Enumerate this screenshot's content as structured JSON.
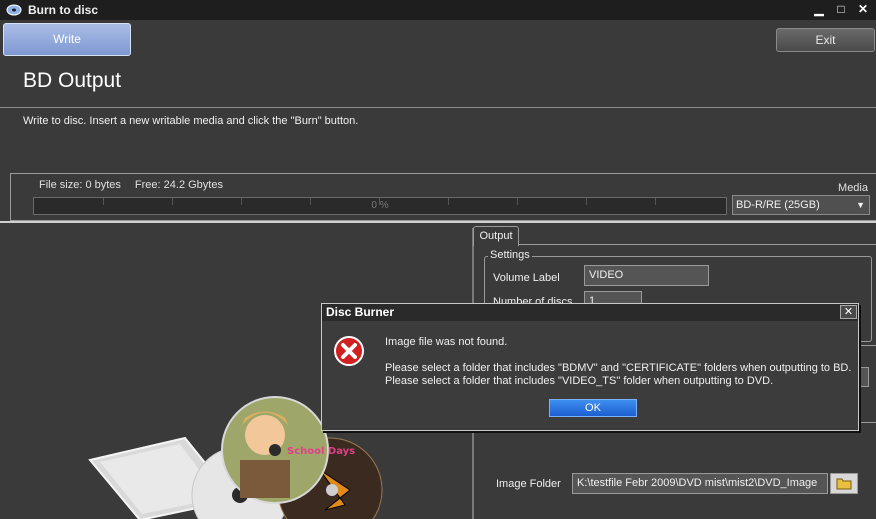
{
  "window": {
    "title": "Burn to disc",
    "minimize": "▁",
    "maximize": "□",
    "close": "✕"
  },
  "toolbar": {
    "write_label": "Write",
    "exit_label": "Exit"
  },
  "page": {
    "title": "BD Output",
    "instructions": "Write to disc. Insert a new writable media and click the \"Burn\" button."
  },
  "progress": {
    "file_size": "File size: 0 bytes",
    "free": "Free: 24.2 Gbytes",
    "percent_text": "0 %",
    "value": 0
  },
  "media": {
    "label": "Media",
    "selected": "BD-R/RE (25GB)"
  },
  "output": {
    "tab_label": "Output",
    "settings_title": "Settings",
    "volume_label_label": "Volume Label",
    "volume_label_value": "VIDEO",
    "discs_label": "Number of discs",
    "discs_value": "1",
    "image_folder_label": "Image Folder",
    "image_folder_value": "K:\\testfile Febr 2009\\DVD mist\\mist2\\DVD_Image"
  },
  "dialog": {
    "title": "Disc Burner",
    "close": "✕",
    "message_line1": "Image file was not found.",
    "message_line2": "Please select a folder that includes \"BDMV\" and \"CERTIFICATE\" folders when outputting to BD.",
    "message_line3": "Please select a folder that includes \"VIDEO_TS\" folder when outputting to DVD.",
    "ok_label": "OK"
  },
  "artwork": {
    "disc_label": "School Days"
  },
  "colors": {
    "accent": "#1d5fd0",
    "write_tab": "#8ea6dc",
    "error": "#d02020"
  }
}
